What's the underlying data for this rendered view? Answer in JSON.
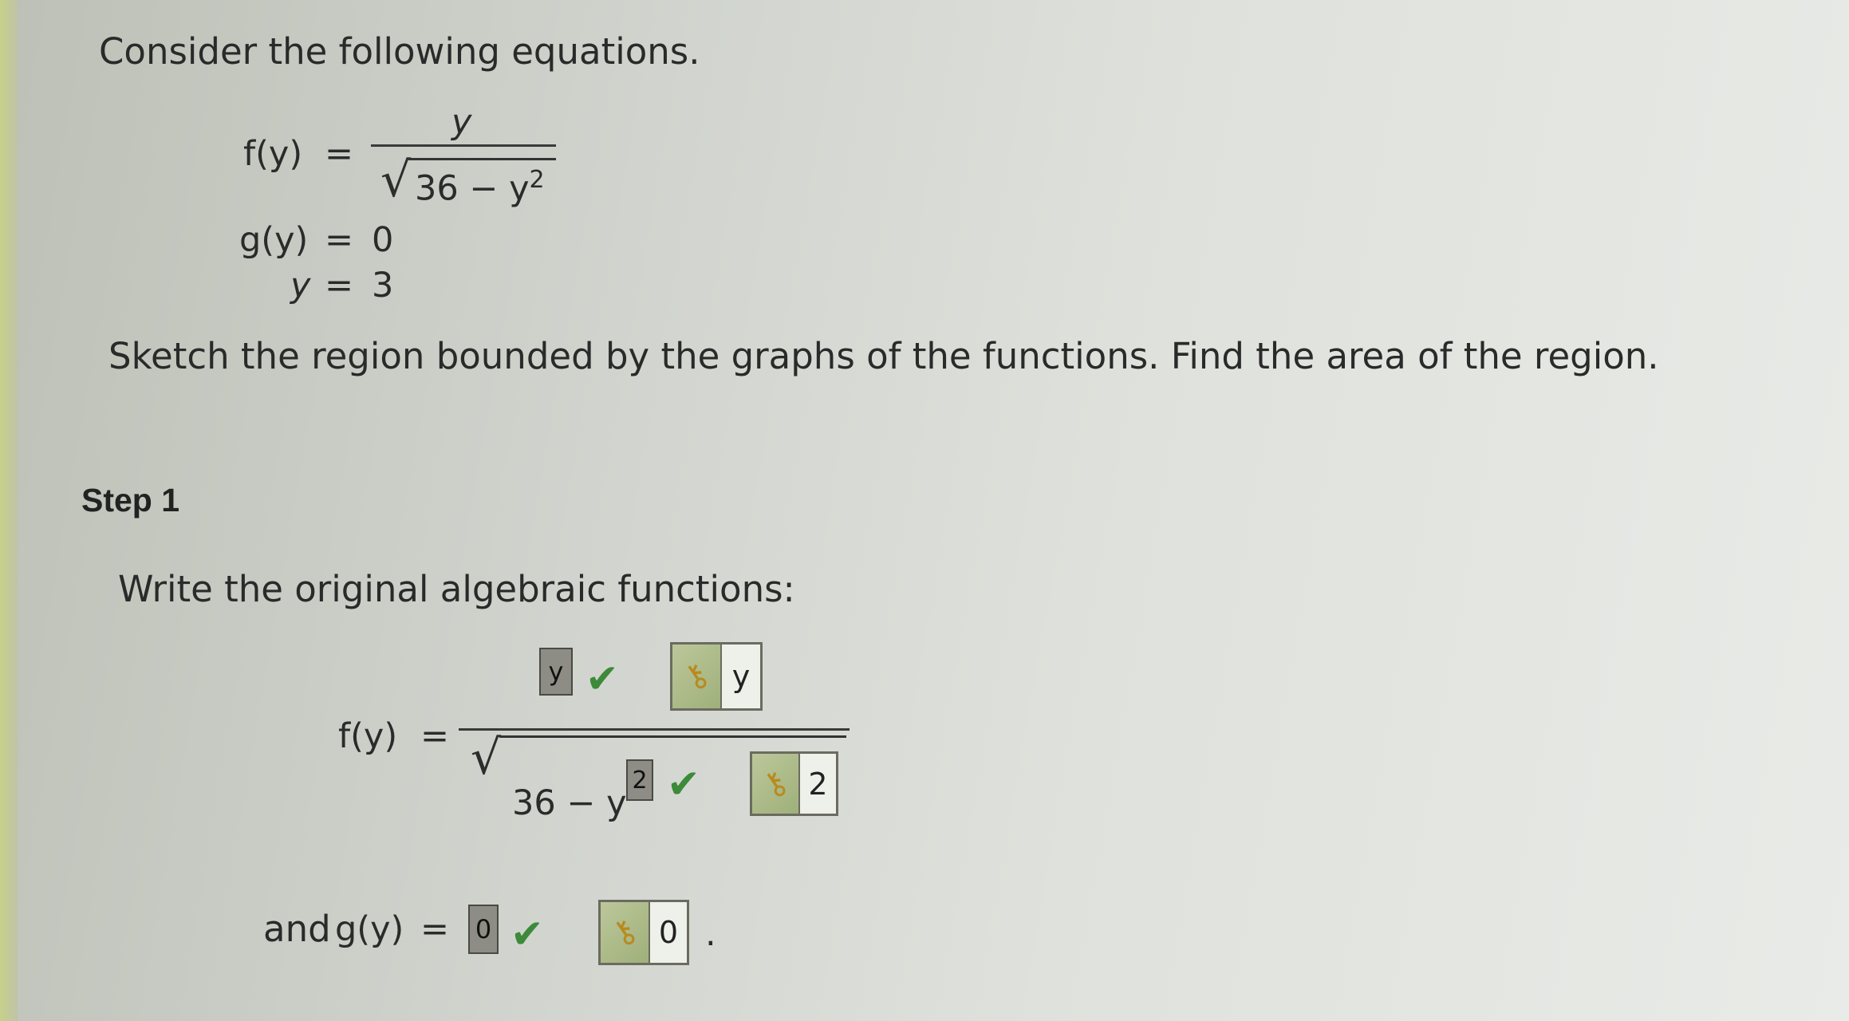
{
  "problem": {
    "intro": "Consider the following equations.",
    "f_lhs": "f(y)",
    "eq": "=",
    "f_numerator": "y",
    "f_radicand_a": "36 − y",
    "f_radicand_exp": "2",
    "g_lhs": "g(y)",
    "g_rhs": "0",
    "y_lhs": "y",
    "y_rhs": "3",
    "instruction": "Sketch the region bounded by the graphs of the functions. Find the area of the region."
  },
  "step1": {
    "title": "Step 1",
    "prompt": "Write the original algebraic functions:",
    "f_lhs": "f(y)",
    "eq": "=",
    "numerator_answer": "y",
    "numerator_key": "y",
    "radicand_prefix": "36 − y",
    "exponent_answer": "2",
    "exponent_key": "2",
    "g_prefix": "and",
    "g_lhs": "g(y)",
    "g_answer": "0",
    "g_key": "0",
    "period": "."
  },
  "icons": {
    "check": "checkmark-icon",
    "key": "key-icon",
    "check_color": "#3d8a3a"
  }
}
